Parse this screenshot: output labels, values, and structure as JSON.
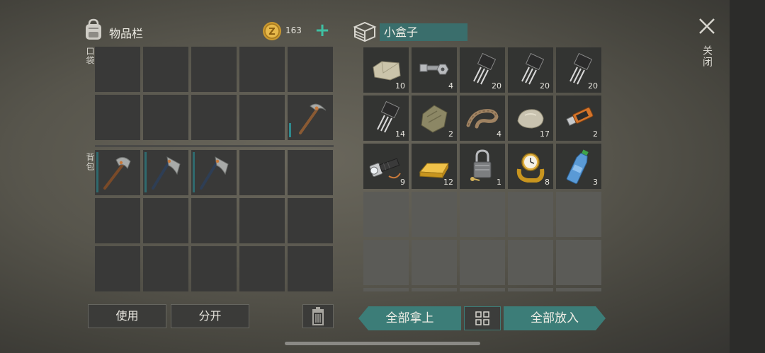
{
  "inventory": {
    "title": "物品栏",
    "coins": "163",
    "coin_add_label": "+",
    "pocket_label": "口袋",
    "backpack_label": "背包"
  },
  "actions": {
    "use_label": "使用",
    "split_label": "分开"
  },
  "container": {
    "name": "小盒子",
    "take_all_label": "全部拿上",
    "put_all_label": "全部放入",
    "items": [
      {
        "name": "stone",
        "qty": "10"
      },
      {
        "name": "nuts-and-bolts",
        "qty": "4"
      },
      {
        "name": "transistor",
        "qty": "20"
      },
      {
        "name": "transistor",
        "qty": "20"
      },
      {
        "name": "transistor",
        "qty": "20"
      },
      {
        "name": "transistor",
        "qty": "14"
      },
      {
        "name": "cloth",
        "qty": "2"
      },
      {
        "name": "rope",
        "qty": "4"
      },
      {
        "name": "rock",
        "qty": "17"
      },
      {
        "name": "usb-drive",
        "qty": "2"
      },
      {
        "name": "flashlight",
        "qty": "9"
      },
      {
        "name": "gold-bar",
        "qty": "12"
      },
      {
        "name": "padlock",
        "qty": "1"
      },
      {
        "name": "gold-watch",
        "qty": "8"
      },
      {
        "name": "water-bottle",
        "qty": "3"
      }
    ]
  },
  "window": {
    "close_label": "关闭"
  },
  "colors": {
    "accent": "#3c7d78",
    "coin_add": "#3fbfa2"
  }
}
